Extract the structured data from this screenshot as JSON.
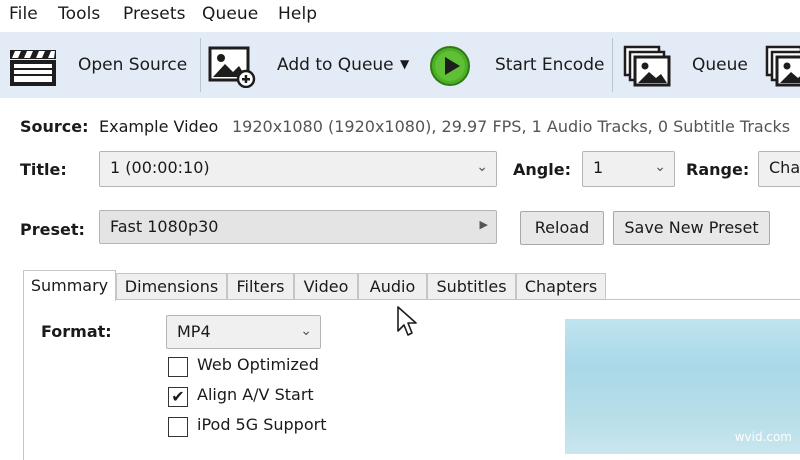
{
  "menu": {
    "items": [
      "File",
      "Tools",
      "Presets",
      "Queue",
      "Help"
    ]
  },
  "toolbar": {
    "open_source": "Open Source",
    "add_to_queue": "Add to Queue",
    "start_encode": "Start Encode",
    "queue": "Queue",
    "icons": {
      "open_source": "clapperboard-icon",
      "add_to_queue": "add-image-icon",
      "start_encode": "play-icon",
      "queue": "image-stack-icon"
    },
    "start_encode_color": "#4caf27"
  },
  "source": {
    "label": "Source:",
    "name": "Example Video",
    "info": "1920x1080 (1920x1080), 29.97 FPS, 1 Audio Tracks, 0 Subtitle Tracks"
  },
  "title_row": {
    "title_label": "Title:",
    "title_value": "1  (00:00:10)",
    "angle_label": "Angle:",
    "angle_value": "1",
    "range_label": "Range:",
    "range_value": "Chap"
  },
  "preset_row": {
    "label": "Preset:",
    "value": "Fast 1080p30",
    "reload": "Reload",
    "save_new": "Save New Preset"
  },
  "tabs": [
    "Summary",
    "Dimensions",
    "Filters",
    "Video",
    "Audio",
    "Subtitles",
    "Chapters"
  ],
  "active_tab": "Summary",
  "summary": {
    "format_label": "Format:",
    "format_value": "MP4",
    "options": [
      {
        "label": "Web Optimized",
        "checked": false
      },
      {
        "label": "Align A/V Start",
        "checked": true
      },
      {
        "label": "iPod 5G Support",
        "checked": false
      }
    ]
  },
  "watermark": "wvid.com"
}
